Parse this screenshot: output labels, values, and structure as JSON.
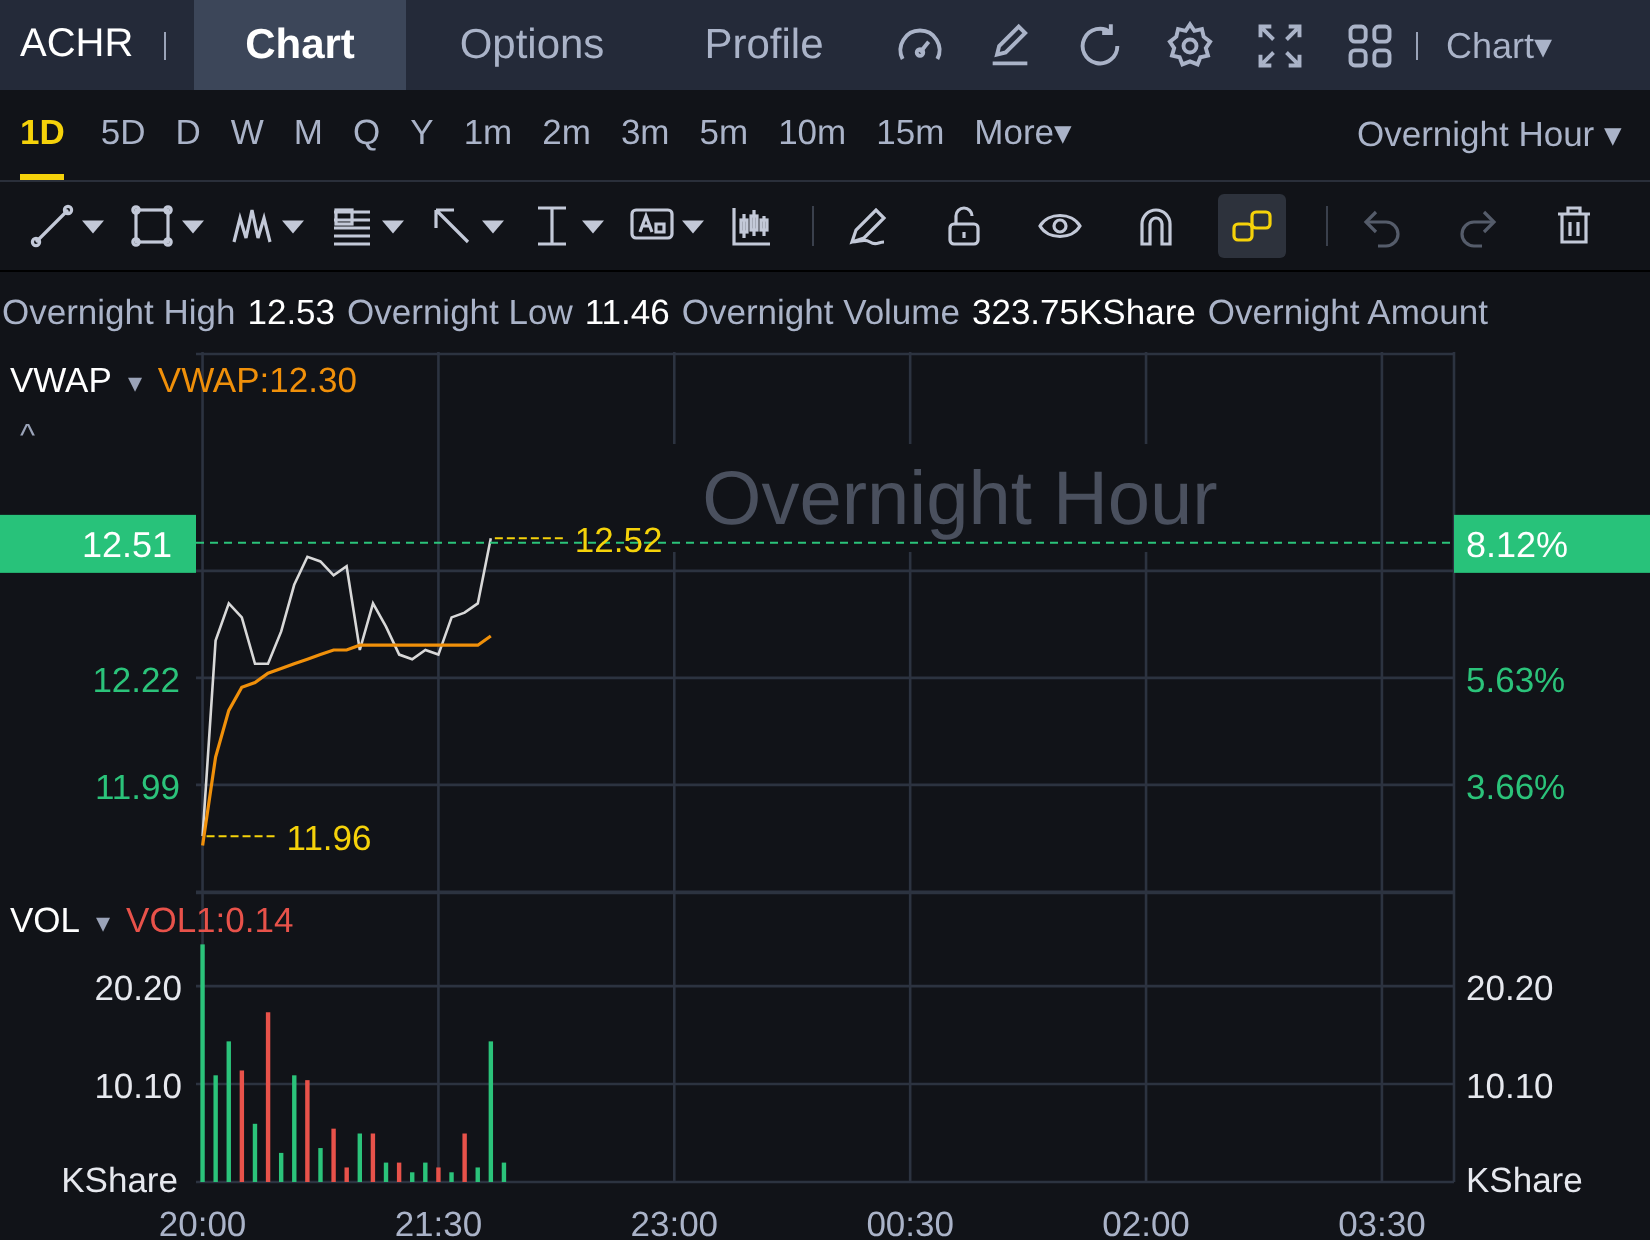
{
  "header": {
    "ticker": "ACHR",
    "tabs": [
      {
        "label": "Chart",
        "selected": true
      },
      {
        "label": "Options",
        "selected": false
      },
      {
        "label": "Profile",
        "selected": false
      }
    ],
    "layout_menu": "Chart▾"
  },
  "periods": {
    "items": [
      {
        "label": "1D",
        "selected": true
      },
      {
        "label": "5D",
        "selected": false
      },
      {
        "label": "D",
        "selected": false
      },
      {
        "label": "W",
        "selected": false
      },
      {
        "label": "M",
        "selected": false
      },
      {
        "label": "Q",
        "selected": false
      },
      {
        "label": "Y",
        "selected": false
      },
      {
        "label": "1m",
        "selected": false
      },
      {
        "label": "2m",
        "selected": false
      },
      {
        "label": "3m",
        "selected": false
      },
      {
        "label": "5m",
        "selected": false
      },
      {
        "label": "10m",
        "selected": false
      },
      {
        "label": "15m",
        "selected": false
      },
      {
        "label": "More▾",
        "selected": false
      }
    ],
    "session_menu": "Overnight Hour ▾"
  },
  "toolbar": {
    "drawing_tools": [
      {
        "dropdown": true
      },
      {
        "dropdown": true
      },
      {
        "dropdown": true
      },
      {
        "dropdown": true
      },
      {
        "dropdown": true
      },
      {
        "dropdown": true
      },
      {
        "dropdown": true
      },
      {
        "dropdown": false
      }
    ],
    "actions": [
      {
        "selected": false
      },
      {
        "selected": false
      },
      {
        "selected": false
      },
      {
        "selected": false
      },
      {
        "selected": true
      }
    ],
    "history": [
      {
        "disabled": true
      },
      {
        "disabled": true
      }
    ]
  },
  "stats": [
    {
      "label": "Overnight High",
      "value": "12.53"
    },
    {
      "label": "Overnight Low",
      "value": "11.46"
    },
    {
      "label": "Overnight Volume",
      "value": "323.75KShare"
    },
    {
      "label": "Overnight Amount"
    }
  ],
  "price_panel": {
    "caret": "▾",
    "reading": "VWAP:12.30",
    "collapse": "^",
    "watermark": "Overnight Hour",
    "last_price": {
      "label": "12.51",
      "change": "8.12%"
    },
    "right_labels": [
      "5.63%",
      "3.66%"
    ],
    "chart_data": {
      "type": "line",
      "grid": true,
      "ylim": [
        11.76,
        12.92
      ],
      "yticks": [
        {
          "value": 12.22,
          "label": "12.22"
        },
        {
          "value": 11.99,
          "label": "11.99"
        }
      ],
      "categories": [
        null,
        null,
        null,
        null,
        null,
        null,
        null,
        null,
        null,
        null,
        null,
        null,
        null,
        null,
        null,
        null,
        null,
        null,
        null,
        null,
        null,
        null,
        null,
        null,
        null,
        null,
        null,
        null,
        null,
        null,
        null,
        null,
        null,
        null,
        null,
        null,
        null,
        null,
        null,
        null,
        null,
        null,
        null,
        null,
        null,
        null,
        null,
        null,
        null,
        null,
        null,
        null,
        null,
        null,
        null,
        null,
        null,
        null,
        null,
        null,
        null,
        null,
        null,
        null,
        null,
        null,
        null,
        null,
        null,
        null,
        null,
        null,
        null,
        null,
        null,
        null,
        null,
        null,
        null,
        null,
        null,
        null,
        null,
        null,
        null,
        null,
        null,
        null,
        null,
        null,
        null,
        null,
        null,
        null,
        null,
        null
      ],
      "series": [
        {
          "color": "#d8d8d8",
          "values": [
            11.88,
            12.3,
            12.38,
            12.35,
            12.25,
            12.25,
            12.32,
            12.42,
            12.48,
            12.47,
            12.44,
            12.46,
            12.28,
            12.38,
            12.33,
            12.27,
            12.26,
            12.28,
            12.27,
            12.35,
            12.36,
            12.38,
            12.52,
            null,
            null,
            null,
            null,
            null,
            null,
            null,
            null,
            null,
            null,
            null,
            null,
            null,
            null,
            null,
            null,
            null,
            null,
            null,
            null,
            null,
            null,
            null,
            null,
            null,
            null,
            null,
            null,
            null,
            null,
            null,
            null,
            null,
            null,
            null,
            null,
            null,
            null,
            null,
            null,
            null,
            null,
            null,
            null,
            null,
            null,
            null,
            null,
            null,
            null,
            null,
            null,
            null,
            null,
            null,
            null,
            null,
            null,
            null,
            null,
            null,
            null,
            null,
            null,
            null,
            null,
            null,
            null,
            null,
            null,
            null,
            null,
            null
          ]
        },
        {
          "name": "VWAP",
          "color": "#f0900a",
          "values": [
            11.86,
            12.05,
            12.15,
            12.2,
            12.21,
            12.23,
            12.24,
            12.25,
            12.26,
            12.27,
            12.28,
            12.28,
            12.29,
            12.29,
            12.29,
            12.29,
            12.29,
            12.29,
            12.29,
            12.29,
            12.29,
            12.29,
            12.31,
            null,
            null,
            null,
            null,
            null,
            null,
            null,
            null,
            null,
            null,
            null,
            null,
            null,
            null,
            null,
            null,
            null,
            null,
            null,
            null,
            null,
            null,
            null,
            null,
            null,
            null,
            null,
            null,
            null,
            null,
            null,
            null,
            null,
            null,
            null,
            null,
            null,
            null,
            null,
            null,
            null,
            null,
            null,
            null,
            null,
            null,
            null,
            null,
            null,
            null,
            null,
            null,
            null,
            null,
            null,
            null,
            null,
            null,
            null,
            null,
            null,
            null,
            null,
            null,
            null,
            null,
            null,
            null,
            null,
            null,
            null,
            null,
            null
          ]
        }
      ],
      "ref_lines": [
        {
          "axis": "y",
          "value": 12.51,
          "color": "#2bc37a"
        }
      ],
      "annotations": [
        "12.52",
        "11.96"
      ]
    }
  },
  "volume_panel": {
    "indicator": "VOL",
    "caret": "▾",
    "reading": "VOL1:0.14",
    "unit_left": "KShare",
    "unit_right": "KShare",
    "chart_data": {
      "type": "bar",
      "grid": true,
      "ylim": [
        0,
        29.9
      ],
      "categories": [
        "20:00",
        null,
        null,
        null,
        null,
        null,
        null,
        null,
        null,
        null,
        null,
        null,
        null,
        null,
        null,
        null,
        null,
        null,
        "21:30",
        null,
        null,
        null,
        null,
        null,
        null,
        null,
        null,
        null,
        null,
        null,
        null,
        null,
        null,
        null,
        null,
        null,
        "23:00",
        null,
        null,
        null,
        null,
        null,
        null,
        null,
        null,
        null,
        null,
        null,
        null,
        null,
        null,
        null,
        null,
        null,
        "00:30",
        null,
        null,
        null,
        null,
        null,
        null,
        null,
        null,
        null,
        null,
        null,
        null,
        null,
        null,
        null,
        null,
        null,
        "02:00",
        null,
        null,
        null,
        null,
        null,
        null,
        null,
        null,
        null,
        null,
        null,
        null,
        null,
        null,
        null,
        null,
        null,
        "03:30",
        null,
        null,
        null,
        null,
        null
      ],
      "yticks": [
        {
          "value": 10.1,
          "label": "10.10"
        },
        {
          "value": 20.2,
          "label": "20.20"
        }
      ],
      "series": [
        {
          "color": "#2bc37a",
          "values": [
            24.5,
            11,
            14.5,
            null,
            6,
            null,
            3,
            11,
            null,
            3.5,
            null,
            null,
            5,
            null,
            2,
            null,
            1,
            2,
            null,
            1,
            null,
            1.5,
            14.5,
            2,
            null,
            null,
            null,
            null,
            null,
            null,
            null,
            null,
            null,
            null,
            null,
            null,
            null,
            null,
            null,
            null,
            null,
            null,
            null,
            null,
            null,
            null,
            null,
            null,
            null,
            null,
            null,
            null,
            null,
            null,
            null,
            null,
            null,
            null,
            null,
            null,
            null,
            null,
            null,
            null,
            null,
            null,
            null,
            null,
            null,
            null,
            null,
            null,
            null,
            null,
            null,
            null,
            null,
            null,
            null,
            null,
            null,
            null,
            null,
            null,
            null,
            null,
            null,
            null,
            null,
            null,
            null,
            null,
            null,
            null,
            null,
            null
          ]
        },
        {
          "color": "#e8524a",
          "values": [
            null,
            null,
            null,
            11.5,
            null,
            17.5,
            null,
            null,
            10.5,
            null,
            5.5,
            1.5,
            null,
            5,
            null,
            2,
            null,
            null,
            1.5,
            null,
            5,
            null,
            null,
            null,
            null,
            null,
            null,
            null,
            null,
            null,
            null,
            null,
            null,
            null,
            null,
            null,
            null,
            null,
            null,
            null,
            null,
            null,
            null,
            null,
            null,
            null,
            null,
            null,
            null,
            null,
            null,
            null,
            null,
            null,
            null,
            null,
            null,
            null,
            null,
            null,
            null,
            null,
            null,
            null,
            null,
            null,
            null,
            null,
            null,
            null,
            null,
            null,
            null,
            null,
            null,
            null,
            null,
            null,
            null,
            null,
            null,
            null,
            null,
            null,
            null,
            null,
            null,
            null,
            null,
            null,
            null,
            null,
            null,
            null,
            null,
            null
          ]
        }
      ]
    }
  }
}
